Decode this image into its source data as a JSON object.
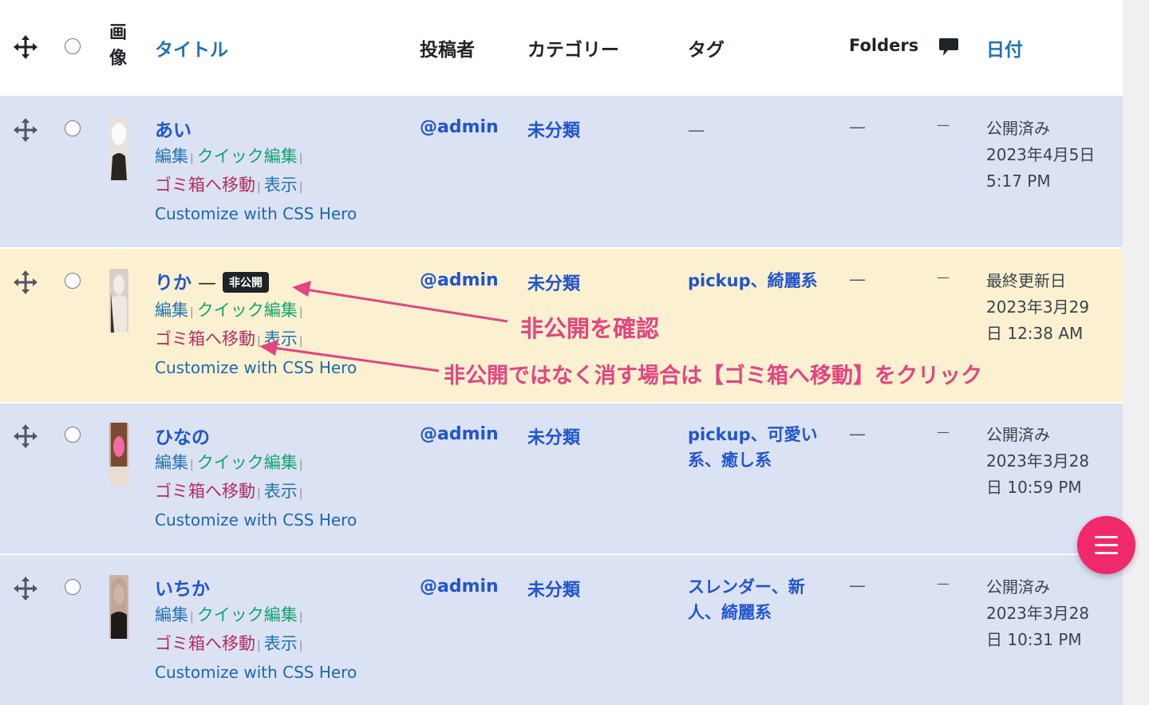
{
  "header": {
    "image": "画像",
    "title": "タイトル",
    "author": "投稿者",
    "category": "カテゴリー",
    "tags": "タグ",
    "folders": "Folders",
    "date": "日付",
    "comments_icon": "comment-bubble-icon"
  },
  "actions": {
    "edit": "編集",
    "quick_edit": "クイック編集",
    "trash": "ゴミ箱へ移動",
    "view": "表示",
    "css_hero": "Customize with CSS Hero",
    "separator": "|"
  },
  "rows": [
    {
      "title": "あい",
      "author": "@admin",
      "category": "未分類",
      "tags": "—",
      "folders": "—",
      "comments": "—",
      "status": "公開済み",
      "date_line1": "2023年4月5日",
      "date_line2": "5:17 PM"
    },
    {
      "title": "りか",
      "title_suffix": "—",
      "badge": "非公開",
      "author": "@admin",
      "category": "未分類",
      "tags": "pickup、綺麗系",
      "folders": "—",
      "comments": "—",
      "status": "最終更新日",
      "date_line1": "2023年3月29",
      "date_line2": "日 12:38 AM"
    },
    {
      "title": "ひなの",
      "author": "@admin",
      "category": "未分類",
      "tags": "pickup、可愛い系、癒し系",
      "folders": "—",
      "comments": "—",
      "status": "公開済み",
      "date_line1": "2023年3月28",
      "date_line2": "日 10:59 PM"
    },
    {
      "title": "いちか",
      "author": "@admin",
      "category": "未分類",
      "tags": "スレンダー、新人、綺麗系",
      "folders": "—",
      "comments": "—",
      "status": "公開済み",
      "date_line1": "2023年3月28",
      "date_line2": "日 10:31 PM"
    }
  ],
  "annotations": {
    "note1": "非公開を確認",
    "note2": "非公開ではなく消す場合は【ゴミ箱へ移動】をクリック",
    "color": "#e2457f"
  },
  "colors": {
    "row_blue": "#dbe2f4",
    "row_yellow": "#fbf1d1",
    "link": "#2255cc",
    "fab": "#f0296a"
  }
}
